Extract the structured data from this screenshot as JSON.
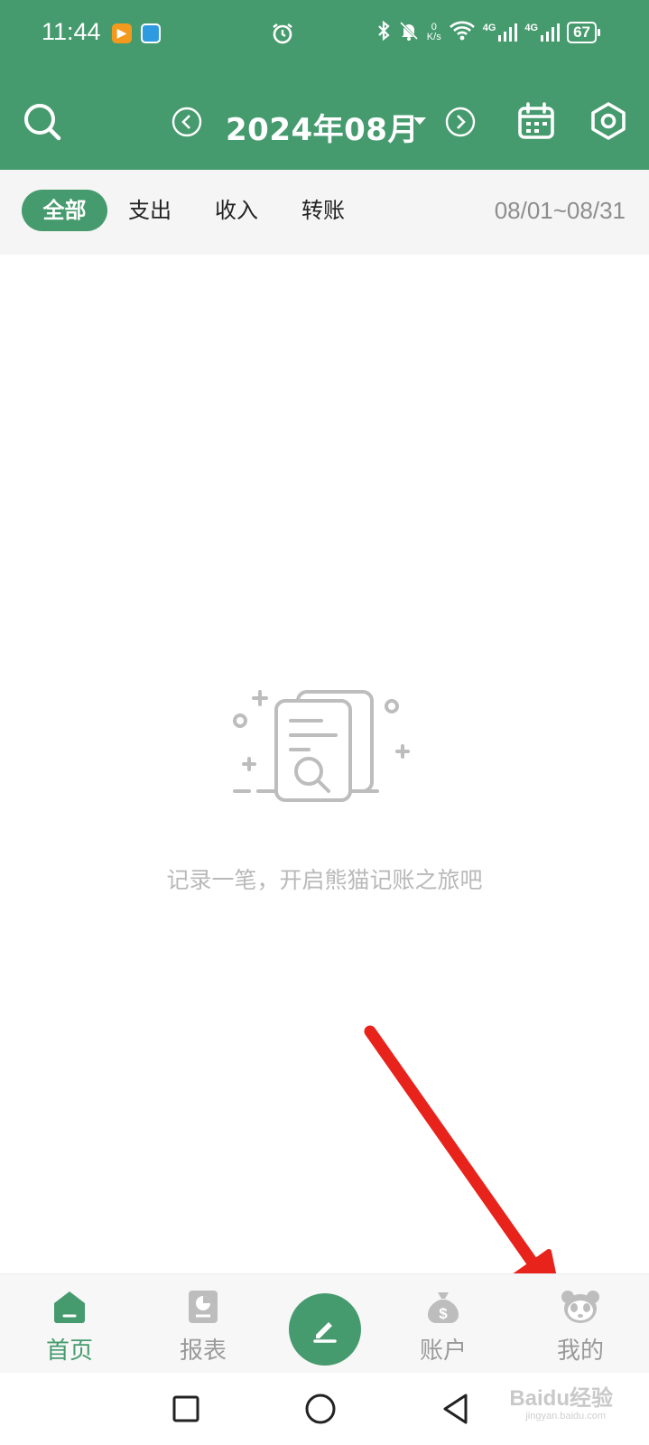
{
  "status_bar": {
    "time": "11:44",
    "net_speed_value": "0",
    "net_speed_unit": "K/s",
    "signal1": "4G",
    "signal2": "4G",
    "battery": "67"
  },
  "header": {
    "month_title": "2024年08月"
  },
  "filter": {
    "tabs": [
      {
        "label": "全部",
        "active": true
      },
      {
        "label": "支出",
        "active": false
      },
      {
        "label": "收入",
        "active": false
      },
      {
        "label": "转账",
        "active": false
      }
    ],
    "date_range": "08/01~08/31"
  },
  "empty_state": {
    "message": "记录一笔，开启熊猫记账之旅吧"
  },
  "bottom_nav": {
    "items": [
      {
        "label": "首页",
        "active": true
      },
      {
        "label": "报表",
        "active": false
      },
      {
        "label": "账户",
        "active": false
      },
      {
        "label": "我的",
        "active": false
      }
    ]
  },
  "watermark": {
    "main": "Baidu经验",
    "sub": "jingyan.baidu.com"
  },
  "colors": {
    "primary": "#469b6e",
    "annotation_arrow": "#e8231c"
  }
}
